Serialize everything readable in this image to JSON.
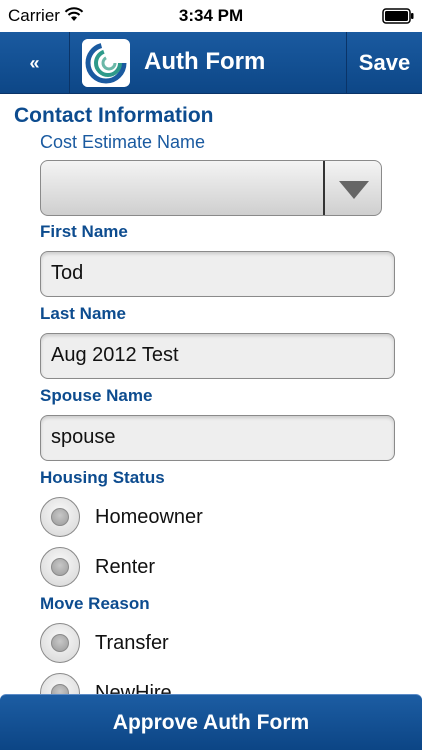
{
  "status_bar": {
    "carrier": "Carrier",
    "time": "3:34 PM"
  },
  "nav": {
    "back_label": "«",
    "title": "Auth Form",
    "save_label": "Save"
  },
  "form": {
    "section_title": "Contact Information",
    "cost_estimate_label": "Cost Estimate Name",
    "cost_estimate_value": "",
    "first_name_label": "First Name",
    "first_name_value": "Tod",
    "last_name_label": "Last Name",
    "last_name_value": "Aug 2012 Test",
    "spouse_name_label": "Spouse Name",
    "spouse_name_value": "spouse",
    "housing_status_label": "Housing Status",
    "housing_options": [
      "Homeowner",
      "Renter"
    ],
    "move_reason_label": "Move Reason",
    "move_reason_options": [
      "Transfer",
      "NewHire"
    ]
  },
  "footer": {
    "approve_label": "Approve Auth Form"
  },
  "colors": {
    "nav": "#0d4787",
    "label": "#0d4c8f",
    "accent": "#1a5aa0"
  },
  "icons": {
    "wifi": "wifi-icon",
    "battery": "battery-icon",
    "logo": "company-logo-icon",
    "dropdown": "dropdown-arrow-icon"
  }
}
